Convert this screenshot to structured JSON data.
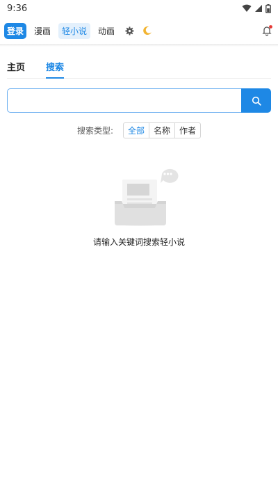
{
  "status_bar": {
    "time": "9:36"
  },
  "nav": {
    "login": "登录",
    "items": [
      "漫画",
      "轻小说",
      "动画"
    ],
    "active_item": "轻小说"
  },
  "tabs": [
    "主页",
    "搜索"
  ],
  "active_tab": "搜索",
  "search": {
    "value": "",
    "placeholder": ""
  },
  "search_type": {
    "label": "搜索类型:",
    "options": [
      "全部",
      "名称",
      "作者"
    ],
    "selected": "全部"
  },
  "empty_state": {
    "message": "请输入关键词搜索轻小说"
  },
  "colors": {
    "accent": "#1e88e5",
    "notification_dot": "#e53935"
  },
  "icons": [
    "wifi-icon",
    "signal-icon",
    "battery-icon",
    "settings-icon",
    "moon-icon",
    "bell-icon",
    "search-icon"
  ]
}
